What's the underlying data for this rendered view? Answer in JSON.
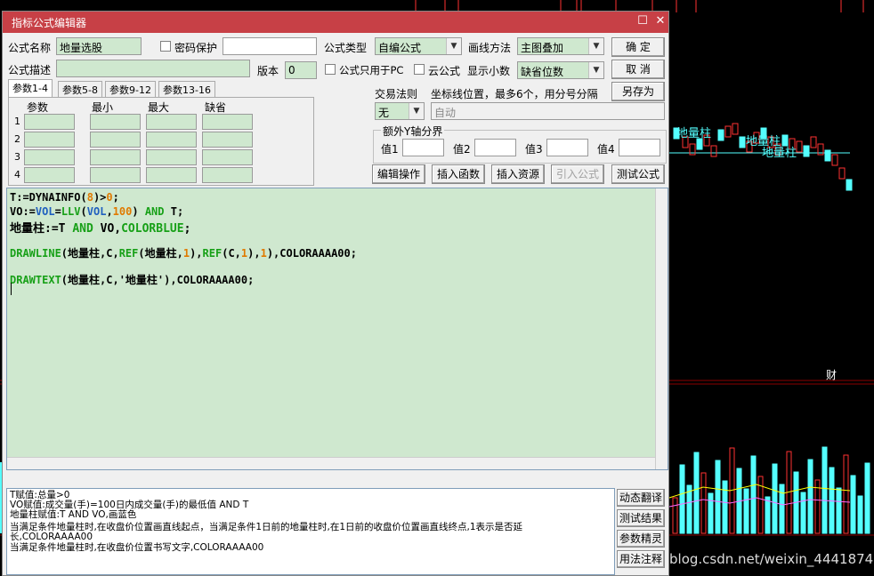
{
  "window": {
    "title": "指标公式编辑器",
    "maximize_glyph": "☐",
    "close_glyph": "✕"
  },
  "form": {
    "name_label": "公式名称",
    "name_value": "地量选股",
    "password_label": "密码保护",
    "type_label": "公式类型",
    "type_value": "自编公式",
    "draw_label": "画线方法",
    "draw_value": "主图叠加",
    "desc_label": "公式描述",
    "desc_value": "",
    "version_label": "版本",
    "version_value": "0",
    "pc_only_label": "公式只用于PC",
    "cloud_label": "云公式",
    "decimals_label": "显示小数",
    "decimals_value": "缺省位数",
    "trade_rule_label": "交易法则",
    "trade_rule_value": "无",
    "coord_label": "坐标线位置，最多6个，用分号分隔",
    "coord_value": "自动",
    "yaxis_legend": "额外Y轴分界",
    "yaxis_values": [
      "值1",
      "值2",
      "值3",
      "值4"
    ]
  },
  "buttons": {
    "ok": "确  定",
    "cancel": "取  消",
    "save_as": "另存为",
    "edit_ops": "编辑操作",
    "insert_func": "插入函数",
    "insert_res": "插入资源",
    "import_formula": "引入公式",
    "test_formula": "测试公式"
  },
  "tabs": [
    "参数1-4",
    "参数5-8",
    "参数9-12",
    "参数13-16"
  ],
  "params": {
    "headers": [
      "参数",
      "最小",
      "最大",
      "缺省"
    ],
    "rows": [
      "1",
      "2",
      "3",
      "4"
    ]
  },
  "code": {
    "line1": [
      [
        "T:=DYNAINFO(",
        "plain"
      ],
      [
        "8",
        "num"
      ],
      [
        ")>",
        "plain"
      ],
      [
        "0",
        "num"
      ],
      [
        ";",
        "plain"
      ]
    ],
    "line2": [
      [
        "VO:=",
        "plain"
      ],
      [
        "VOL",
        "kw-blue"
      ],
      [
        "=",
        "plain"
      ],
      [
        "LLV",
        "kw-green"
      ],
      [
        "(",
        "plain"
      ],
      [
        "VOL",
        "kw-blue"
      ],
      [
        ",",
        "plain"
      ],
      [
        "100",
        "num"
      ],
      [
        ") ",
        "plain"
      ],
      [
        "AND",
        "kw-green"
      ],
      [
        " T;",
        "plain"
      ]
    ],
    "line3": [
      [
        "地量柱:=T ",
        "plain"
      ],
      [
        "AND",
        "kw-green"
      ],
      [
        " VO,",
        "plain"
      ],
      [
        "COLORBLUE",
        "kw-green"
      ],
      [
        ";",
        "plain"
      ]
    ],
    "line5": [
      [
        "DRAWLINE",
        "kw-green"
      ],
      [
        "(地量柱,C,",
        "plain"
      ],
      [
        "REF",
        "kw-green"
      ],
      [
        "(地量柱,",
        "plain"
      ],
      [
        "1",
        "num"
      ],
      [
        "),",
        "plain"
      ],
      [
        "REF",
        "kw-green"
      ],
      [
        "(C,",
        "plain"
      ],
      [
        "1",
        "num"
      ],
      [
        "),",
        "plain"
      ],
      [
        "1",
        "num"
      ],
      [
        "),COLORAAAA00;",
        "plain"
      ]
    ],
    "line7": [
      [
        "DRAWTEXT",
        "kw-green"
      ],
      [
        "(地量柱,C,'地量柱'),COLORAAAA00;",
        "plain"
      ]
    ]
  },
  "output": {
    "lines": [
      "T赋值:总量>0",
      "VO赋值:成交量(手)=100日内成交量(手)的最低值 AND T",
      "地量柱赋值:T AND VO,画蓝色",
      "当满足条件地量柱时,在收盘价位置画直线起点，当满足条件1日前的地量柱时,在1日前的收盘价位置画直线终点,1表示是否延",
      "长,COLORAAAA00",
      "当满足条件地量柱时,在收盘价位置书写文字,COLORAAAA00"
    ]
  },
  "side_buttons": [
    "动态翻译",
    "测试结果",
    "参数精灵",
    "用法注释"
  ],
  "chart_labels": [
    "地量柱",
    "地量柱",
    "地量柱",
    "财"
  ],
  "watermark": "blog.csdn.net/weixin_44418748",
  "colors": {
    "title_bg": "#c74046",
    "editor_bg": "#cfe8cf",
    "bg": "#000000",
    "up": "#ff3232",
    "down": "#54ffff"
  }
}
